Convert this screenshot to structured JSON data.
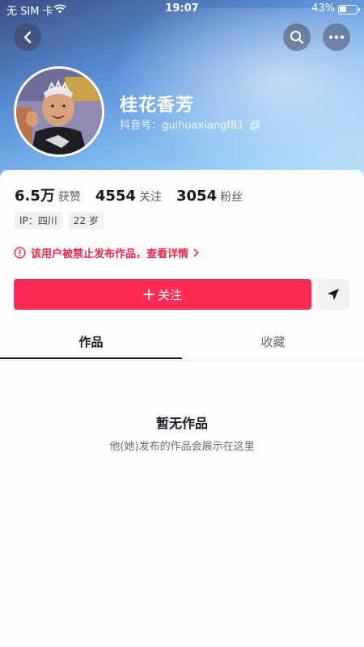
{
  "status_bar": {
    "carrier": "无 SIM 卡",
    "time": "19:07",
    "battery": "43%"
  },
  "profile": {
    "nickname": "桂花香芳",
    "account_id": "抖音号：guihuaxiangf81",
    "stats": [
      {
        "value": "6.5万",
        "label": "获赞"
      },
      {
        "value": "4554",
        "label": "关注"
      },
      {
        "value": "3054",
        "label": "粉丝"
      }
    ],
    "tags": [
      "IP：四川",
      "22 岁"
    ],
    "notice": "该用户被禁止发布作品，查看详情"
  },
  "actions": {
    "follow_label": "关注"
  },
  "tabs": [
    {
      "label": "作品",
      "active": true
    },
    {
      "label": "收藏",
      "active": false
    }
  ],
  "empty": {
    "title": "暂无作品",
    "subtitle": "他(她)发布的作品会展示在这里"
  },
  "colors": {
    "accent": "#fe2c55",
    "warning": "#e9294f"
  }
}
